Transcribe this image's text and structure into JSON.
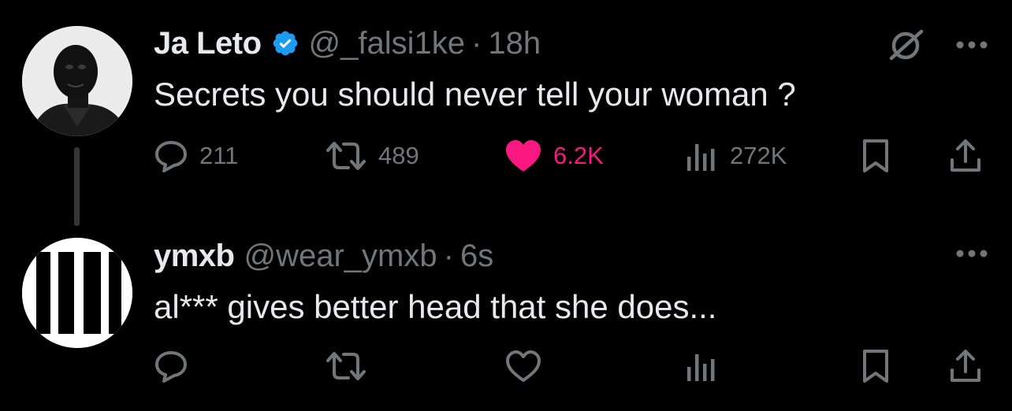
{
  "colors": {
    "background": "#000000",
    "text_primary": "#e7e9ea",
    "text_secondary": "#71767b",
    "like_active": "#f91880",
    "verified_badge": "#1d9bf0"
  },
  "tweets": [
    {
      "author": {
        "name": "Ja Leto",
        "handle": "@_falsi1ke",
        "verified": true,
        "avatar_icon": "person-photo-avatar"
      },
      "separator": "·",
      "time": "18h",
      "text": "Secrets you should never tell your woman ?",
      "icons": {
        "grok": "grok-icon",
        "more": "more-icon"
      },
      "actions": {
        "reply": {
          "icon": "reply-icon",
          "count": "211"
        },
        "retweet": {
          "icon": "retweet-icon",
          "count": "489"
        },
        "like": {
          "icon": "heart-filled-icon",
          "count": "6.2K",
          "active": true
        },
        "views": {
          "icon": "views-icon",
          "count": "272K"
        },
        "bookmark": {
          "icon": "bookmark-icon"
        },
        "share": {
          "icon": "share-icon"
        }
      }
    },
    {
      "author": {
        "name": "ymxb",
        "handle": "@wear_ymxb",
        "verified": false,
        "avatar_icon": "ymxb-bars-logo"
      },
      "separator": "·",
      "time": "6s",
      "text": "al*** gives better head that she does...",
      "icons": {
        "more": "more-icon"
      },
      "actions": {
        "reply": {
          "icon": "reply-icon",
          "count": ""
        },
        "retweet": {
          "icon": "retweet-icon",
          "count": ""
        },
        "like": {
          "icon": "heart-outline-icon",
          "count": "",
          "active": false
        },
        "views": {
          "icon": "views-icon",
          "count": ""
        },
        "bookmark": {
          "icon": "bookmark-icon"
        },
        "share": {
          "icon": "share-icon"
        }
      }
    }
  ]
}
